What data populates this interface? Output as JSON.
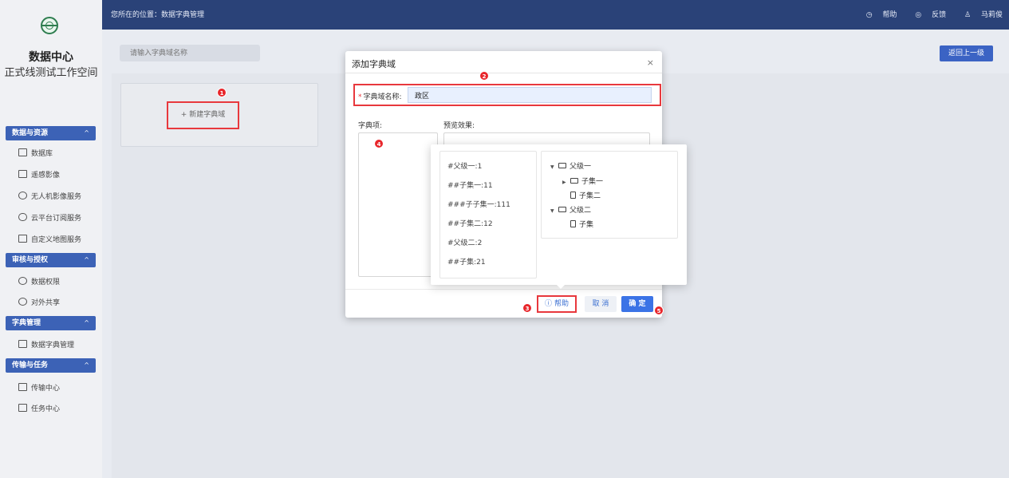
{
  "sidebar": {
    "app_title": "数据中心",
    "workspace": "正式线测试工作空间",
    "sections": [
      {
        "label": "数据与资源",
        "items": [
          "数据库",
          "遥感影像",
          "无人机影像服务",
          "云平台订阅服务",
          "自定义地图服务"
        ]
      },
      {
        "label": "审核与授权",
        "items": [
          "数据权限",
          "对外共享"
        ]
      },
      {
        "label": "字典管理",
        "items": [
          "数据字典管理"
        ]
      },
      {
        "label": "传输与任务",
        "items": [
          "传输中心",
          "任务中心"
        ]
      }
    ]
  },
  "topbar": {
    "breadcrumb": "您所在的位置：数据字典管理",
    "help": "帮助",
    "feedback": "反馈",
    "user": "马莉俊"
  },
  "main": {
    "search_placeholder": "请输入字典域名称",
    "back_label": "返回上一级",
    "new_dict_label": "+ 新建字典域"
  },
  "dialog": {
    "title": "添加字典域",
    "close": "×",
    "name_label": "字典域名称:",
    "name_value": "政区",
    "items_label": "字典项:",
    "preview_label": "预览效果:",
    "help_label": "帮助",
    "cancel_label": "取 消",
    "confirm_label": "确 定"
  },
  "popover": {
    "example_lines": [
      "#父级一:1",
      "##子集一:11",
      "###子子集一:111",
      "##子集二:12",
      "#父级二:2",
      "##子集:21"
    ],
    "tree": [
      {
        "label": "父级一",
        "kind": "folder-open",
        "caret": "▼"
      },
      {
        "label": "子集一",
        "kind": "folder",
        "caret": "▶"
      },
      {
        "label": "子集二",
        "kind": "file",
        "caret": ""
      },
      {
        "label": "父级二",
        "kind": "folder-open",
        "caret": "▼"
      },
      {
        "label": "子集",
        "kind": "file",
        "caret": ""
      }
    ]
  },
  "markers": [
    "1",
    "2",
    "3",
    "4",
    "5"
  ],
  "colors": {
    "accent": "#3b63c4",
    "topbar": "#2a4278",
    "highlight": "#e8383d"
  }
}
